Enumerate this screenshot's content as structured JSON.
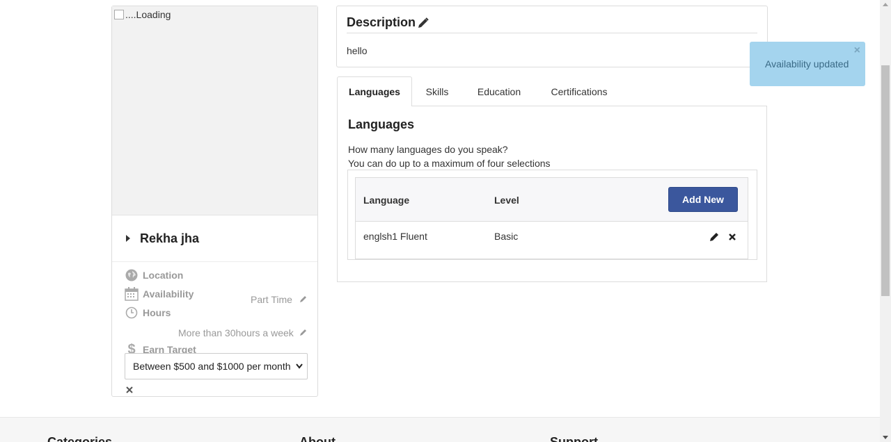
{
  "profile": {
    "photo_alt": "....Loading",
    "name": "Rekha jha",
    "location_label": "Location",
    "availability_label": "Availability",
    "availability_value": "Part Time",
    "hours_label": "Hours",
    "hours_value": "More than 30hours a week",
    "earn_label": "Earn Target",
    "earn_value": "Between $500 and $1000 per month"
  },
  "description": {
    "title": "Description",
    "text": "hello"
  },
  "tabs": [
    {
      "label": "Languages",
      "active": true
    },
    {
      "label": "Skills",
      "active": false
    },
    {
      "label": "Education",
      "active": false
    },
    {
      "label": "Certifications",
      "active": false
    }
  ],
  "languages": {
    "title": "Languages",
    "question": "How many languages do you speak?",
    "hint": "You can do up to a maximum of four selections",
    "col_language": "Language",
    "col_level": "Level",
    "add_label": "Add New",
    "rows": [
      {
        "language": "englsh1 Fluent",
        "level": "Basic"
      }
    ]
  },
  "toast": {
    "message": "Availability updated",
    "close": "×"
  },
  "footer": {
    "col1": "Categories",
    "col2": "About",
    "col3": "Support"
  },
  "colors": {
    "primary_button": "#3b579d",
    "toast_bg": "#a4d4ee"
  }
}
